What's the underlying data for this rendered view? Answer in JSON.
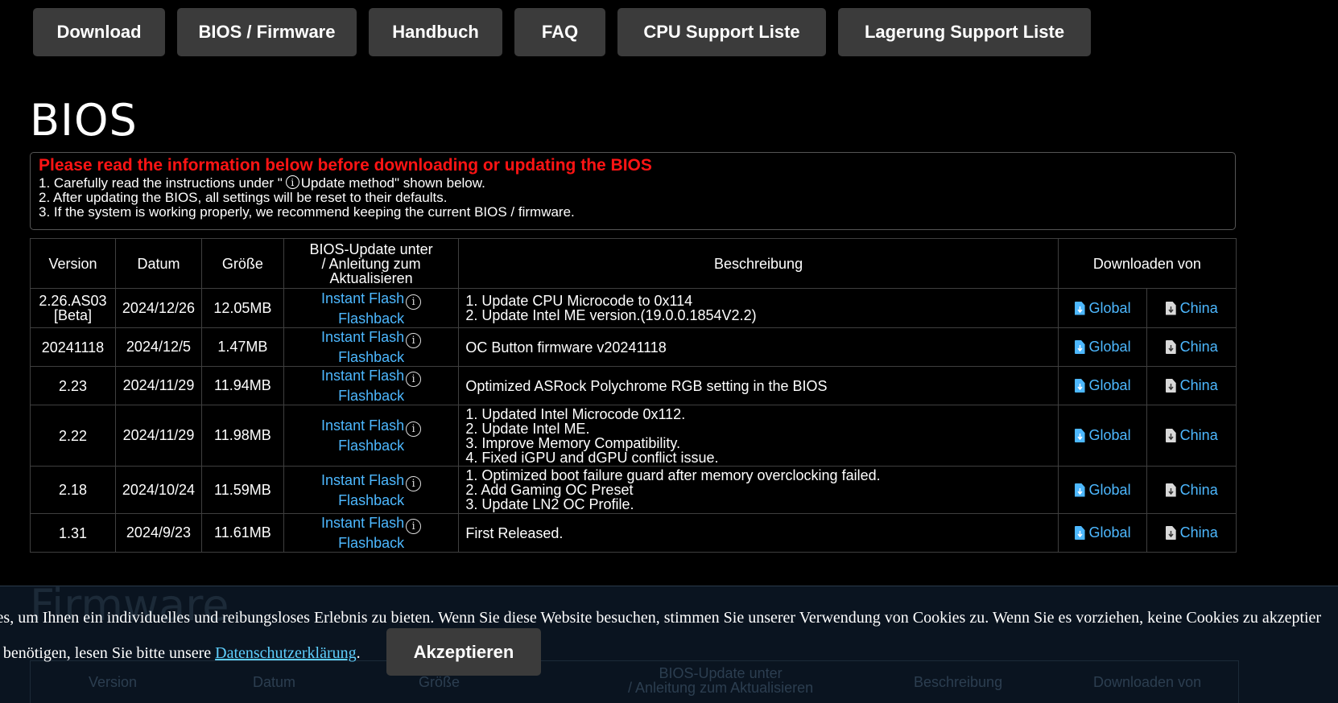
{
  "nav": {
    "items": [
      "Download",
      "BIOS / Firmware",
      "Handbuch",
      "FAQ",
      "CPU Support Liste",
      "Lagerung Support Liste"
    ]
  },
  "bios_title": "BIOS",
  "warning": {
    "title": "Please read the information below before downloading or updating the BIOS",
    "line1_pre": "1. Carefully read the instructions under \"",
    "line1_post": "Update method\" shown below.",
    "line2": "2. After updating the BIOS, all settings will be reset to their defaults.",
    "line3": "3. If the system is working properly, we recommend keeping the current BIOS / firmware."
  },
  "table": {
    "headers": {
      "version": "Version",
      "datum": "Datum",
      "groesse": "Größe",
      "update_l1": "BIOS-Update unter",
      "update_l2": "/ Anleitung zum",
      "update_l3": "Aktualisieren",
      "beschreibung": "Beschreibung",
      "download": "Downloaden von"
    },
    "link_instant": "Instant Flash",
    "link_flashback": "Flashback",
    "link_global": "Global",
    "link_china": "China",
    "rows": [
      {
        "version": "2.26.AS03 [Beta]",
        "datum": "2024/12/26",
        "size": "12.05MB",
        "desc": [
          "1. Update CPU Microcode to 0x114",
          "2. Update Intel ME version.(19.0.0.1854V2.2)"
        ]
      },
      {
        "version": "20241118",
        "datum": "2024/12/5",
        "size": "1.47MB",
        "desc": [
          "OC Button firmware v20241118"
        ]
      },
      {
        "version": "2.23",
        "datum": "2024/11/29",
        "size": "11.94MB",
        "desc": [
          "Optimized ASRock Polychrome RGB setting in the BIOS"
        ]
      },
      {
        "version": "2.22",
        "datum": "2024/11/29",
        "size": "11.98MB",
        "desc": [
          "1. Updated Intel Microcode 0x112.",
          "2. Update Intel ME.",
          "3. Improve Memory Compatibility.",
          "4. Fixed iGPU and dGPU conflict issue."
        ]
      },
      {
        "version": "2.18",
        "datum": "2024/10/24",
        "size": "11.59MB",
        "desc": [
          "1. Optimized boot failure guard after memory overclocking failed.",
          "2. Add Gaming OC Preset",
          "3. Update LN2 OC Profile."
        ]
      },
      {
        "version": "1.31",
        "datum": "2024/9/23",
        "size": "11.61MB",
        "desc": [
          "First Released."
        ]
      }
    ]
  },
  "cookie": {
    "line1": "okies, um Ihnen ein individuelles und reibungsloses Erlebnis zu bieten. Wenn Sie diese Website besuchen, stimmen Sie unserer Verwendung von Cookies zu. Wenn Sie es vorziehen, keine Cookies zu akzeptier",
    "line2_pre": "nen benötigen, lesen Sie bitte unsere ",
    "link": "Datenschutzerklärung",
    "line2_post": ".",
    "accept": "Akzeptieren",
    "ghost_title": "Firmware",
    "ghost_headers": [
      "Version",
      "Datum",
      "Größe",
      "BIOS-Update unter",
      "/ Anleitung zum Aktualisieren",
      "Beschreibung",
      "Downloaden von"
    ]
  },
  "colors": {
    "accent_link": "#4db8ff",
    "warning_red": "#ff1414",
    "button_bg": "#3b3b3b",
    "cookie_bg": "#0a1420"
  },
  "icons": [
    "info-icon",
    "global-file-download-icon",
    "china-file-download-icon"
  ]
}
